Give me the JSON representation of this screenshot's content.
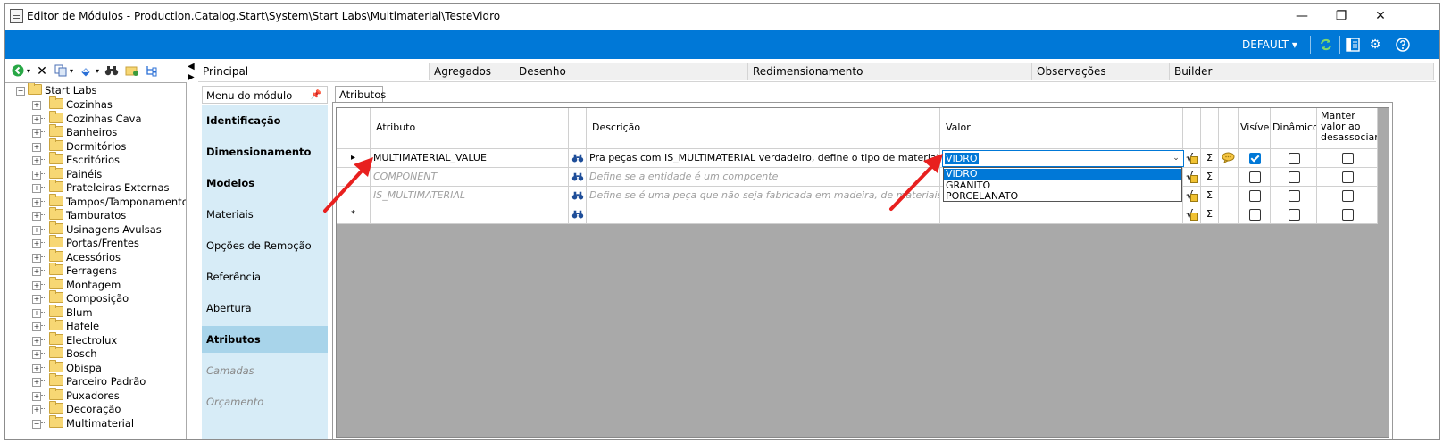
{
  "window": {
    "title": "Editor de Módulos - Production.Catalog.Start\\System\\Start Labs\\Multimaterial\\TesteVidro",
    "controls": {
      "minimize": "—",
      "maximize": "❐",
      "close": "✕"
    }
  },
  "ribbon": {
    "profile": "DEFAULT",
    "profile_caret": "▾",
    "icons": [
      "refresh-icon",
      "layout-icon",
      "settings-icon",
      "help-icon"
    ],
    "accent": "#0078d7"
  },
  "tree_toolbar": {
    "icons": [
      "back-icon",
      "delete-icon",
      "copy-icon",
      "paste-icon",
      "find-icon",
      "folder-icon",
      "tree-icon"
    ]
  },
  "tree": {
    "root": "Start Labs",
    "items": [
      "Cozinhas",
      "Cozinhas Cava",
      "Banheiros",
      "Dormitórios",
      "Escritórios",
      "Painéis",
      "Prateleiras Externas",
      "Tampos/Tamponamentos",
      "Tamburatos",
      "Usinagens Avulsas",
      "Portas/Frentes",
      "Acessórios",
      "Ferragens",
      "Montagem",
      "Composição",
      "Blum",
      "Hafele",
      "Electrolux",
      "Bosch",
      "Obispa",
      "Parceiro Padrão",
      "Puxadores",
      "Decoração",
      "Multimaterial"
    ]
  },
  "tabs": [
    "Principal",
    "Agregados",
    "Desenho",
    "Redimensionamento",
    "Observações",
    "Builder"
  ],
  "module_menu": {
    "header": "Menu do módulo",
    "items": [
      {
        "label": "Identificação",
        "style": "bold"
      },
      {
        "label": "Dimensionamento",
        "style": "bold"
      },
      {
        "label": "Modelos",
        "style": "bold"
      },
      {
        "label": "Materiais",
        "style": "normal"
      },
      {
        "label": "Opções de Remoção",
        "style": "normal"
      },
      {
        "label": "Referência",
        "style": "normal"
      },
      {
        "label": "Abertura",
        "style": "normal"
      },
      {
        "label": "Atributos",
        "style": "selected"
      },
      {
        "label": "Camadas",
        "style": "disabled"
      },
      {
        "label": "Orçamento",
        "style": "disabled"
      }
    ]
  },
  "attributes": {
    "tab_label": "Atributos",
    "columns": {
      "attribute": "Atributo",
      "description": "Descrição",
      "value": "Valor",
      "visible": "Visível",
      "dynamic": "Dinâmico",
      "keep": "Manter valor ao desassociar"
    },
    "rows": [
      {
        "marker": "▸",
        "attribute": "MULTIMATERIAL_VALUE",
        "description": "Pra peças com IS_MULTIMATERIAL verdadeiro, define o tipo de material",
        "value": "VIDRO",
        "visible": true,
        "dynamic": false,
        "keep": false,
        "disabled": false
      },
      {
        "marker": "",
        "attribute": "COMPONENT",
        "description": "Define se a entidade é um compoente",
        "value": "",
        "visible": false,
        "dynamic": false,
        "keep": false,
        "disabled": true
      },
      {
        "marker": "",
        "attribute": "IS_MULTIMATERIAL",
        "description": "Define se é uma peça que não seja fabricada em madeira, de materiais variados como",
        "value": "",
        "visible": false,
        "dynamic": false,
        "keep": false,
        "disabled": true
      },
      {
        "marker": "*",
        "attribute": "",
        "description": "",
        "value": "",
        "visible": false,
        "dynamic": false,
        "keep": false,
        "disabled": false
      }
    ],
    "dropdown_options": [
      "VIDRO",
      "GRANITO",
      "PORCELANATO"
    ],
    "dropdown_selected": "VIDRO",
    "sigma": "Σ"
  },
  "annotation_color": "#e8201f"
}
